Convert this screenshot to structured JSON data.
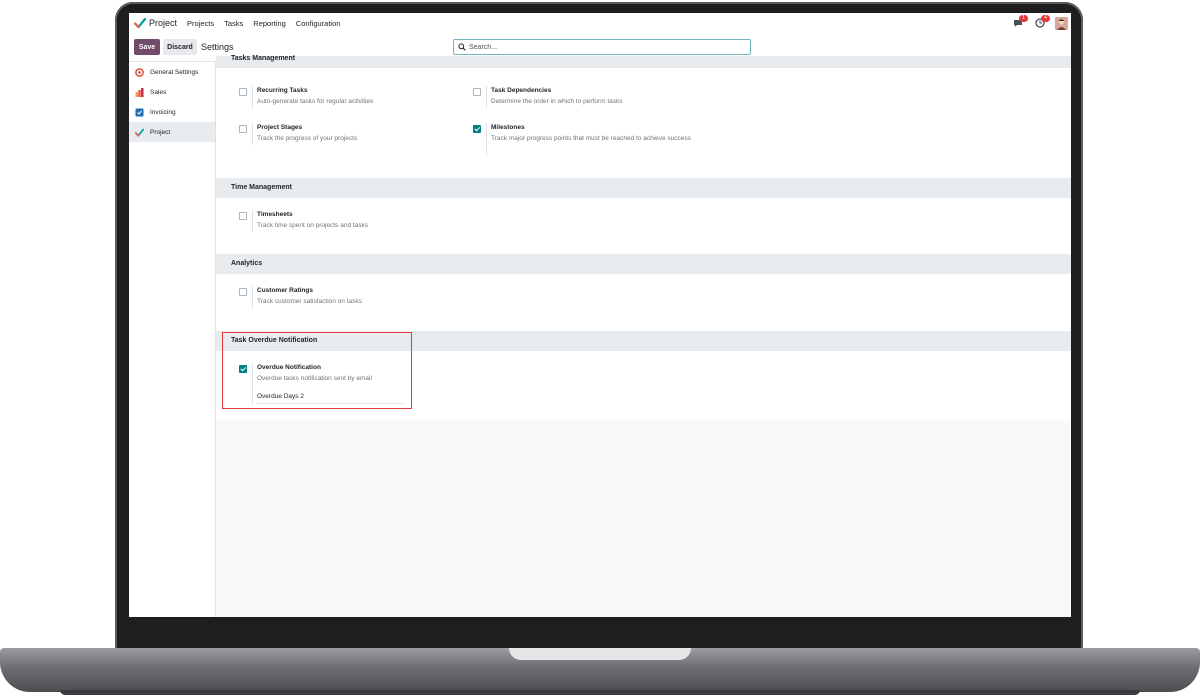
{
  "navbar": {
    "app_name": "Project",
    "menu": [
      "Projects",
      "Tasks",
      "Reporting",
      "Configuration"
    ],
    "messages_badge": "1",
    "activities_badge": "4",
    "icons": {
      "app": "project-check-icon",
      "messages": "chat-icon",
      "activities": "clock-icon",
      "user": "avatar"
    }
  },
  "control_panel": {
    "save_label": "Save",
    "discard_label": "Discard",
    "title": "Settings",
    "search_placeholder": "Search..."
  },
  "sidebar": {
    "items": [
      {
        "label": "General Settings",
        "icon": "general-settings-icon"
      },
      {
        "label": "Sales",
        "icon": "sales-icon"
      },
      {
        "label": "Invoicing",
        "icon": "invoicing-icon"
      },
      {
        "label": "Project",
        "icon": "project-icon",
        "active": true
      }
    ]
  },
  "sections": {
    "tasks_management": {
      "title": "Tasks Management",
      "settings": [
        {
          "title": "Recurring Tasks",
          "desc": "Auto-generate tasks for regular activities",
          "checked": false
        },
        {
          "title": "Task Dependencies",
          "desc": "Determine the order in which to perform tasks",
          "checked": false
        },
        {
          "title": "Project Stages",
          "desc": "Track the progress of your projects",
          "checked": false
        },
        {
          "title": "Milestones",
          "desc": "Track major progress points that must be reached to achieve success",
          "checked": true
        }
      ]
    },
    "time_management": {
      "title": "Time Management",
      "settings": [
        {
          "title": "Timesheets",
          "desc": "Track time spent on projects and tasks",
          "checked": false
        }
      ]
    },
    "analytics": {
      "title": "Analytics",
      "settings": [
        {
          "title": "Customer Ratings",
          "desc": "Track customer satisfaction on tasks",
          "checked": false
        }
      ]
    },
    "task_overdue": {
      "title": "Task Overdue Notification",
      "settings": [
        {
          "title": "Overdue Notification",
          "desc": "Overdue tasks notification sent by email",
          "checked": true,
          "extra": "Overdue Days 2"
        }
      ]
    }
  },
  "colors": {
    "brand": "#714b67",
    "checkbox_checked": "#017e84",
    "highlight": "#e03b3b",
    "section_bg": "#e9ecef"
  }
}
